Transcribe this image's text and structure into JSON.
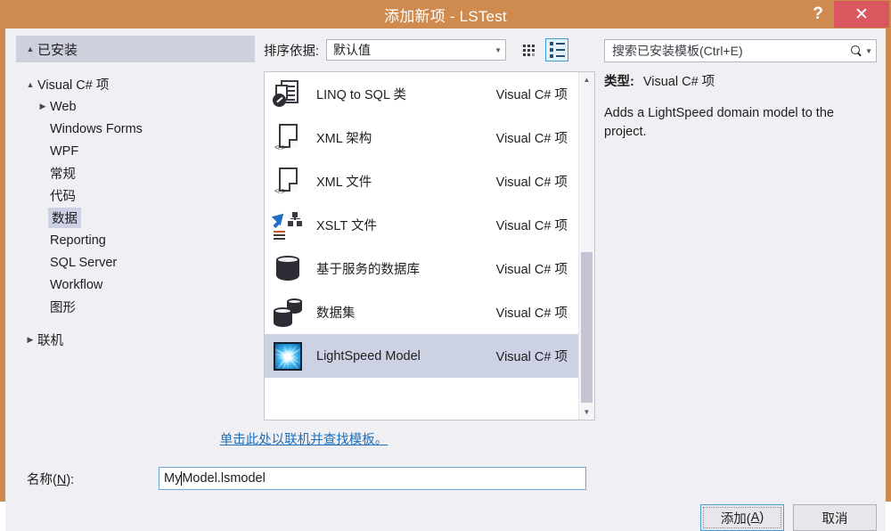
{
  "window": {
    "title": "添加新项 - LSTest",
    "help_label": "?",
    "close_label": "✕"
  },
  "sidebar": {
    "header": "已安装",
    "nodes": [
      {
        "label": "Visual C# 项",
        "level": 0,
        "arrow": "▲",
        "expanded": true,
        "selected": false
      },
      {
        "label": "Web",
        "level": 1,
        "arrow": "▶",
        "expanded": false,
        "selected": false
      },
      {
        "label": "Windows Forms",
        "level": 1,
        "arrow": "",
        "expanded": false,
        "selected": false
      },
      {
        "label": "WPF",
        "level": 1,
        "arrow": "",
        "expanded": false,
        "selected": false
      },
      {
        "label": "常规",
        "level": 1,
        "arrow": "",
        "expanded": false,
        "selected": false
      },
      {
        "label": "代码",
        "level": 1,
        "arrow": "",
        "expanded": false,
        "selected": false
      },
      {
        "label": "数据",
        "level": 1,
        "arrow": "",
        "expanded": false,
        "selected": true
      },
      {
        "label": "Reporting",
        "level": 1,
        "arrow": "",
        "expanded": false,
        "selected": false
      },
      {
        "label": "SQL Server",
        "level": 1,
        "arrow": "",
        "expanded": false,
        "selected": false
      },
      {
        "label": "Workflow",
        "level": 1,
        "arrow": "",
        "expanded": false,
        "selected": false
      },
      {
        "label": "图形",
        "level": 0,
        "arrow": "",
        "expanded": false,
        "selected": false
      },
      {
        "label": "联机",
        "level": 0,
        "arrow": "▶",
        "expanded": false,
        "selected": false,
        "group_gap": true
      }
    ]
  },
  "toolbar": {
    "sort_label": "排序依据:",
    "sort_value": "默认值",
    "caret": "▼",
    "grid_view_name": "grid-view",
    "list_view_name": "list-view",
    "active_view": "list"
  },
  "search": {
    "placeholder": "搜索已安装模板(Ctrl+E)",
    "caret": "▼"
  },
  "templates": {
    "kind_column": "Visual C# 项",
    "items": [
      {
        "name": "LINQ to SQL 类",
        "kind": "Visual C# 项",
        "icon": "linq-to-sql-icon",
        "selected": false
      },
      {
        "name": "XML 架构",
        "kind": "Visual C# 项",
        "icon": "xml-schema-icon",
        "selected": false
      },
      {
        "name": "XML 文件",
        "kind": "Visual C# 项",
        "icon": "xml-file-icon",
        "selected": false
      },
      {
        "name": "XSLT 文件",
        "kind": "Visual C# 项",
        "icon": "xslt-file-icon",
        "selected": false
      },
      {
        "name": "基于服务的数据库",
        "kind": "Visual C# 项",
        "icon": "service-database-icon",
        "selected": false
      },
      {
        "name": "数据集",
        "kind": "Visual C# 项",
        "icon": "dataset-icon",
        "selected": false
      },
      {
        "name": "LightSpeed Model",
        "kind": "Visual C# 项",
        "icon": "lightspeed-model-icon",
        "selected": true
      }
    ]
  },
  "details": {
    "type_label": "类型:",
    "type_value": "Visual C# 项",
    "description": "Adds a LightSpeed domain model to the project."
  },
  "online": {
    "link_text": "单击此处以联机并查找模板。"
  },
  "name_field": {
    "label_prefix": "名称(",
    "label_mnemonic": "N",
    "label_suffix": "):",
    "value_before_caret": "My",
    "value_after_caret": "Model.lsmodel",
    "full_value": "MyModel.lsmodel"
  },
  "footer": {
    "add_prefix": "添加(",
    "add_mnemonic": "A",
    "add_suffix": ")",
    "cancel_label": "取消"
  },
  "scrollbar": {
    "up_arrow": "▲",
    "down_arrow": "▼"
  },
  "colors": {
    "titlebar": "#cf8b4f",
    "close_button": "#d9575f",
    "selection": "#cdd1e4",
    "tree_header": "#cfd0dd",
    "link": "#1c6eb8",
    "accent_blue": "#3f9bd8"
  }
}
